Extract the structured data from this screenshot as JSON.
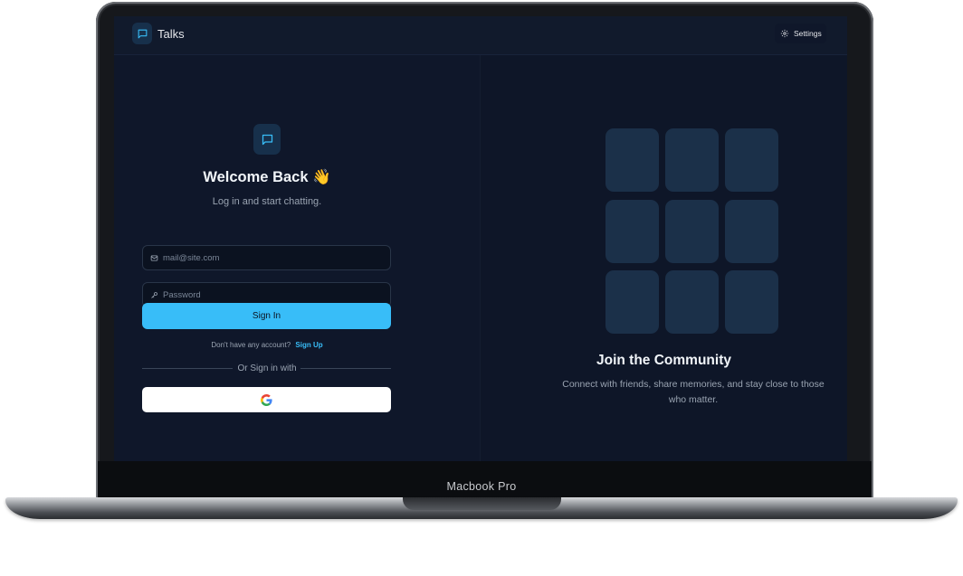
{
  "device": {
    "label": "Macbook Pro"
  },
  "header": {
    "app_name": "Talks",
    "settings_label": "Settings"
  },
  "login": {
    "title": "Welcome Back 👋",
    "subtitle": "Log in and start chatting.",
    "email_placeholder": "mail@site.com",
    "password_placeholder": "Password",
    "signin_label": "Sign In",
    "no_account_text": "Don't have any account?",
    "signup_label": "Sign Up",
    "divider_text": "Or Sign in with"
  },
  "promo": {
    "title": "Join the Community",
    "description": "Connect with friends, share memories, and stay close to those who matter.",
    "tile_count": 9
  },
  "colors": {
    "accent": "#38bdf8",
    "background": "#0f172a",
    "tile": "#1b3049"
  },
  "icons": [
    "message-square-icon",
    "gear-icon",
    "mail-icon",
    "key-icon",
    "google-icon"
  ]
}
